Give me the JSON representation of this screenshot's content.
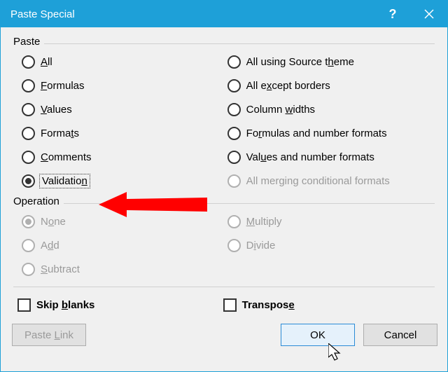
{
  "window": {
    "title": "Paste Special"
  },
  "groups": {
    "paste_label": "Paste",
    "operation_label": "Operation"
  },
  "paste_left": {
    "all": "All",
    "formulas": "Formulas",
    "values": "Values",
    "formats": "Formats",
    "comments": "Comments",
    "validation": "Validation"
  },
  "paste_right": {
    "all_source_theme": "All using Source theme",
    "all_except_borders": "All except borders",
    "column_widths": "Column widths",
    "formulas_number_formats": "Formulas and number formats",
    "values_number_formats": "Values and number formats",
    "all_merging_conditional": "All merging conditional formats"
  },
  "operation_left": {
    "none": "None",
    "add": "Add",
    "subtract": "Subtract"
  },
  "operation_right": {
    "multiply": "Multiply",
    "divide": "Divide"
  },
  "checks": {
    "skip_blanks": "Skip blanks",
    "transpose": "Transpose"
  },
  "buttons": {
    "paste_link": "Paste Link",
    "ok": "OK",
    "cancel": "Cancel"
  },
  "selected_paste": "validation",
  "selected_operation": "none"
}
